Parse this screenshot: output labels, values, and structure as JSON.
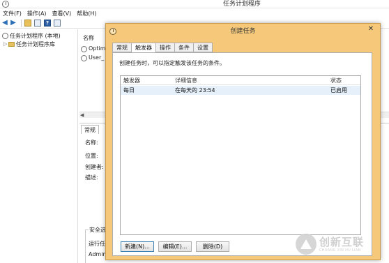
{
  "background": {
    "title": "任务计划程序",
    "menu": [
      "文件(F)",
      "操作(A)",
      "查看(V)",
      "帮助(H)"
    ],
    "tree": {
      "root": "任务计划程序 (本地)",
      "library": "任务计划程序库"
    },
    "list": {
      "header": "名称",
      "rows": [
        "Optim",
        "User_"
      ]
    },
    "detail": {
      "tab": "常规",
      "labels": [
        "名称:",
        "位置:",
        "创建者:",
        "描述:"
      ],
      "security": [
        "安全选",
        "运行任",
        "Admin"
      ]
    }
  },
  "dialog": {
    "title": "创建任务",
    "close_glyph": "✕",
    "tabs": [
      "常规",
      "触发器",
      "操作",
      "条件",
      "设置"
    ],
    "active_tab": "触发器",
    "description": "创建任务时，可以指定触发该任务的条件。",
    "table": {
      "columns": [
        "触发器",
        "详细信息",
        "状态"
      ],
      "rows": [
        {
          "trigger": "每日",
          "details": "在每天的 23:54",
          "status": "已启用"
        }
      ]
    },
    "buttons": {
      "new": "新建(N)...",
      "edit": "编辑(E)...",
      "delete": "删除(D)"
    }
  },
  "watermark": {
    "cn": "创新互联",
    "en": "CHUANG XIN HU LIAN"
  },
  "colors": {
    "dialog_frame": "#f6c97a",
    "selected_row": "#e5f0fb",
    "accent_blue": "#2c6fb7"
  }
}
